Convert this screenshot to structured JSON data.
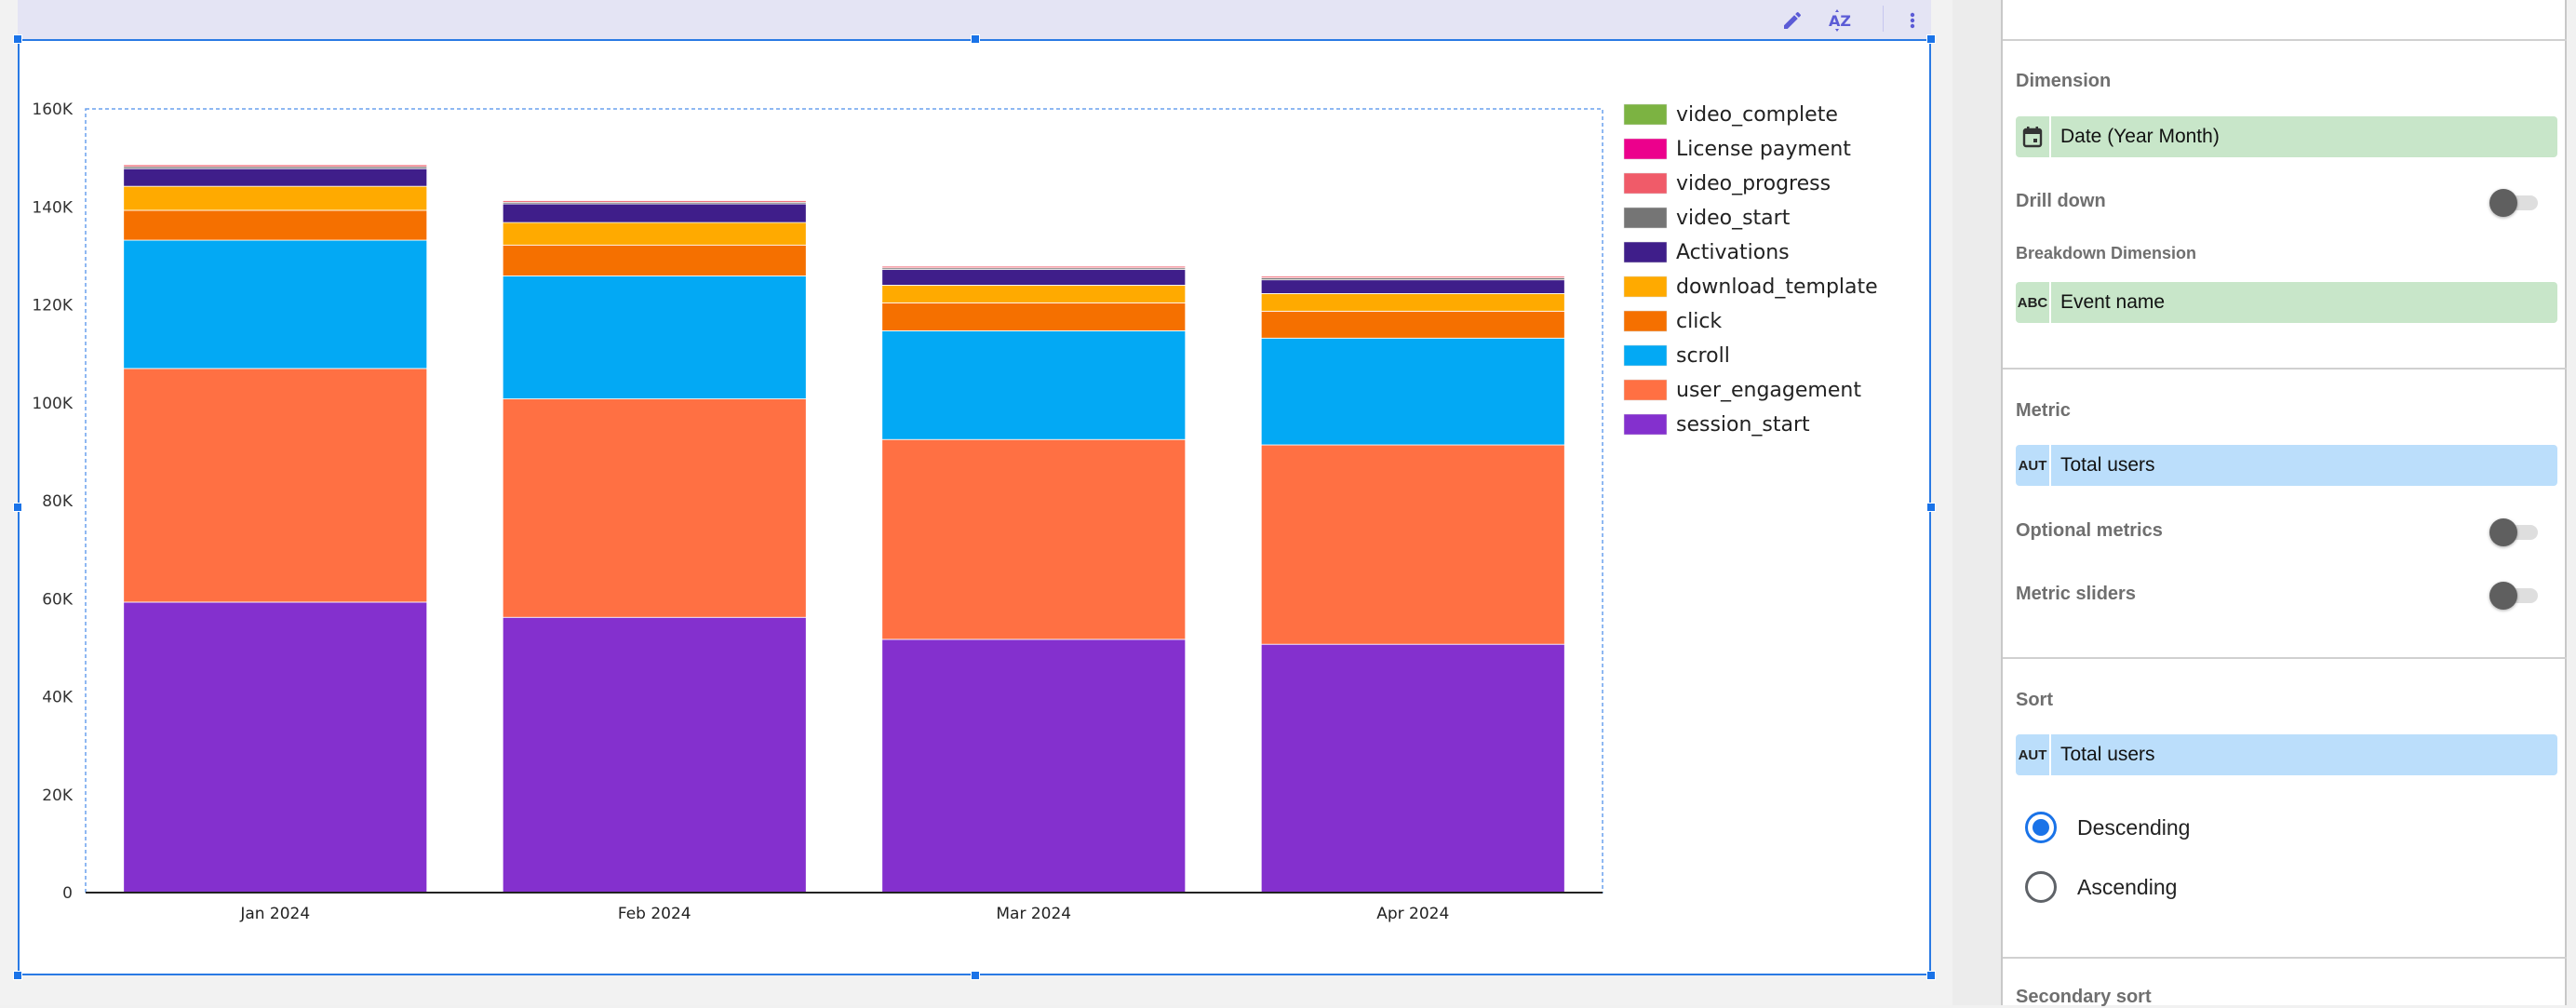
{
  "toolbar": {
    "icons": [
      "edit-icon",
      "sort-az-icon",
      "more-vert-icon"
    ]
  },
  "chart_data": {
    "type": "bar",
    "stacked": true,
    "title": "",
    "xlabel": "",
    "ylabel": "",
    "categories": [
      "Jan 2024",
      "Feb 2024",
      "Mar 2024",
      "Apr 2024"
    ],
    "ylim": [
      0,
      160000
    ],
    "yticks": [
      0,
      20000,
      40000,
      60000,
      80000,
      100000,
      120000,
      140000,
      160000
    ],
    "ytick_labels": [
      "0",
      "20K",
      "40K",
      "60K",
      "80K",
      "100K",
      "120K",
      "140K",
      "160K"
    ],
    "legend_position": "right",
    "grid": false,
    "series": [
      {
        "name": "session_start",
        "color": "#8430ce",
        "values": [
          59300,
          56200,
          51700,
          50700
        ]
      },
      {
        "name": "user_engagement",
        "color": "#ff7043",
        "values": [
          47700,
          44600,
          40800,
          40700
        ]
      },
      {
        "name": "scroll",
        "color": "#03a9f4",
        "values": [
          26200,
          25100,
          22200,
          21800
        ]
      },
      {
        "name": "click",
        "color": "#f57000",
        "values": [
          6100,
          6300,
          5700,
          5500
        ]
      },
      {
        "name": "download_template",
        "color": "#ffaa00",
        "values": [
          4900,
          4600,
          3600,
          3600
        ]
      },
      {
        "name": "Activations",
        "color": "#3f1e8a",
        "values": [
          3600,
          3800,
          3200,
          2800
        ]
      },
      {
        "name": "video_start",
        "color": "#757575",
        "values": [
          400,
          350,
          350,
          400
        ]
      },
      {
        "name": "video_progress",
        "color": "#f05b69",
        "values": [
          400,
          350,
          350,
          350
        ]
      },
      {
        "name": "License payment",
        "color": "#ec008c",
        "values": [
          100,
          100,
          100,
          100
        ]
      },
      {
        "name": "video_complete",
        "color": "#7cb342",
        "values": [
          50,
          50,
          50,
          50
        ]
      }
    ],
    "legend_order": [
      "video_complete",
      "License payment",
      "video_progress",
      "video_start",
      "Activations",
      "download_template",
      "click",
      "scroll",
      "user_engagement",
      "session_start"
    ]
  },
  "panel": {
    "dimension": {
      "label": "Dimension",
      "icon": "calendar-icon",
      "value": "Date (Year Month)"
    },
    "drill_down": {
      "label": "Drill down",
      "on": false
    },
    "breakdown": {
      "label": "Breakdown Dimension",
      "icon_text": "ABC",
      "value": "Event name"
    },
    "metric": {
      "label": "Metric",
      "icon_text": "AUT",
      "value": "Total users"
    },
    "optional_metrics": {
      "label": "Optional metrics",
      "on": false
    },
    "metric_sliders": {
      "label": "Metric sliders",
      "on": false
    },
    "sort": {
      "label": "Sort",
      "icon_text": "AUT",
      "value": "Total users"
    },
    "sort_order": {
      "options": [
        "Descending",
        "Ascending"
      ],
      "selected": "Descending"
    },
    "secondary_sort": {
      "label": "Secondary sort"
    }
  },
  "colors": {
    "accent": "#1a73e8",
    "dimension_chip": "#c8e6c9",
    "metric_chip": "#bbdefb"
  }
}
